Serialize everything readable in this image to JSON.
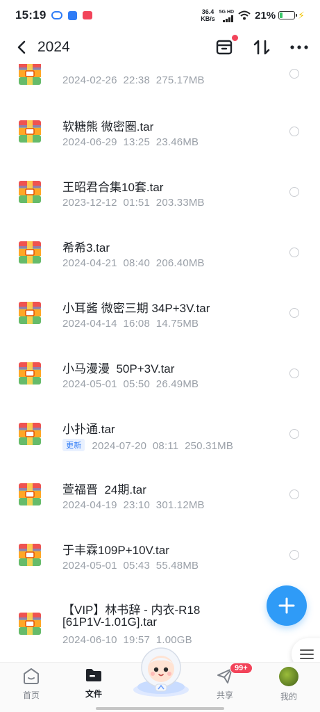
{
  "status_bar": {
    "time": "15:19",
    "net_speed": "36.4",
    "net_unit": "KB/s",
    "signal_label": "5G HD",
    "battery": "21%",
    "battery_level": 0.21
  },
  "header": {
    "title": "2024"
  },
  "files": [
    {
      "name": "",
      "date": "2024-02-26",
      "time": "22:38",
      "size": "275.17MB",
      "badge": ""
    },
    {
      "name": "软糖熊 微密圈.tar",
      "date": "2024-06-29",
      "time": "13:25",
      "size": "23.46MB",
      "badge": ""
    },
    {
      "name": "王昭君合集10套.tar",
      "date": "2023-12-12",
      "time": "01:51",
      "size": "203.33MB",
      "badge": ""
    },
    {
      "name": "希希3.tar",
      "date": "2024-04-21",
      "time": "08:40",
      "size": "206.40MB",
      "badge": ""
    },
    {
      "name": "小耳酱 微密三期 34P+3V.tar",
      "date": "2024-04-14",
      "time": "16:08",
      "size": "14.75MB",
      "badge": ""
    },
    {
      "name": "小马漫漫  50P+3V.tar",
      "date": "2024-05-01",
      "time": "05:50",
      "size": "26.49MB",
      "badge": ""
    },
    {
      "name": "小扑通.tar",
      "date": "2024-07-20",
      "time": "08:11",
      "size": "250.31MB",
      "badge": "更新"
    },
    {
      "name": "萱福晋  24期.tar",
      "date": "2024-04-19",
      "time": "23:10",
      "size": "301.12MB",
      "badge": ""
    },
    {
      "name": "于丰霖109P+10V.tar",
      "date": "2024-05-01",
      "time": "05:43",
      "size": "55.48MB",
      "badge": ""
    },
    {
      "name": "【VIP】林书辞 - 内衣-R18",
      "name_line2": "[61P1V-1.01G].tar",
      "date": "2024-06-10",
      "time": "19:57",
      "size": "1.00GB",
      "badge": ""
    }
  ],
  "bottom_nav": {
    "home": "首页",
    "files": "文件",
    "share": "共享",
    "share_badge": "99+",
    "mine": "我的"
  },
  "colors": {
    "accent": "#2f9bf7",
    "badge_red": "#f2445a",
    "archive_red": "#ef5350",
    "archive_orange": "#ffa726",
    "archive_green": "#66bb6a",
    "archive_blue": "#42a5f5"
  },
  "icons": {
    "back": "back-arrow-icon",
    "archive": "archive-box-icon",
    "sort": "sort-icon",
    "more": "more-icon",
    "file": "zip-archive-icon",
    "add": "plus-icon",
    "menu": "menu-icon"
  }
}
